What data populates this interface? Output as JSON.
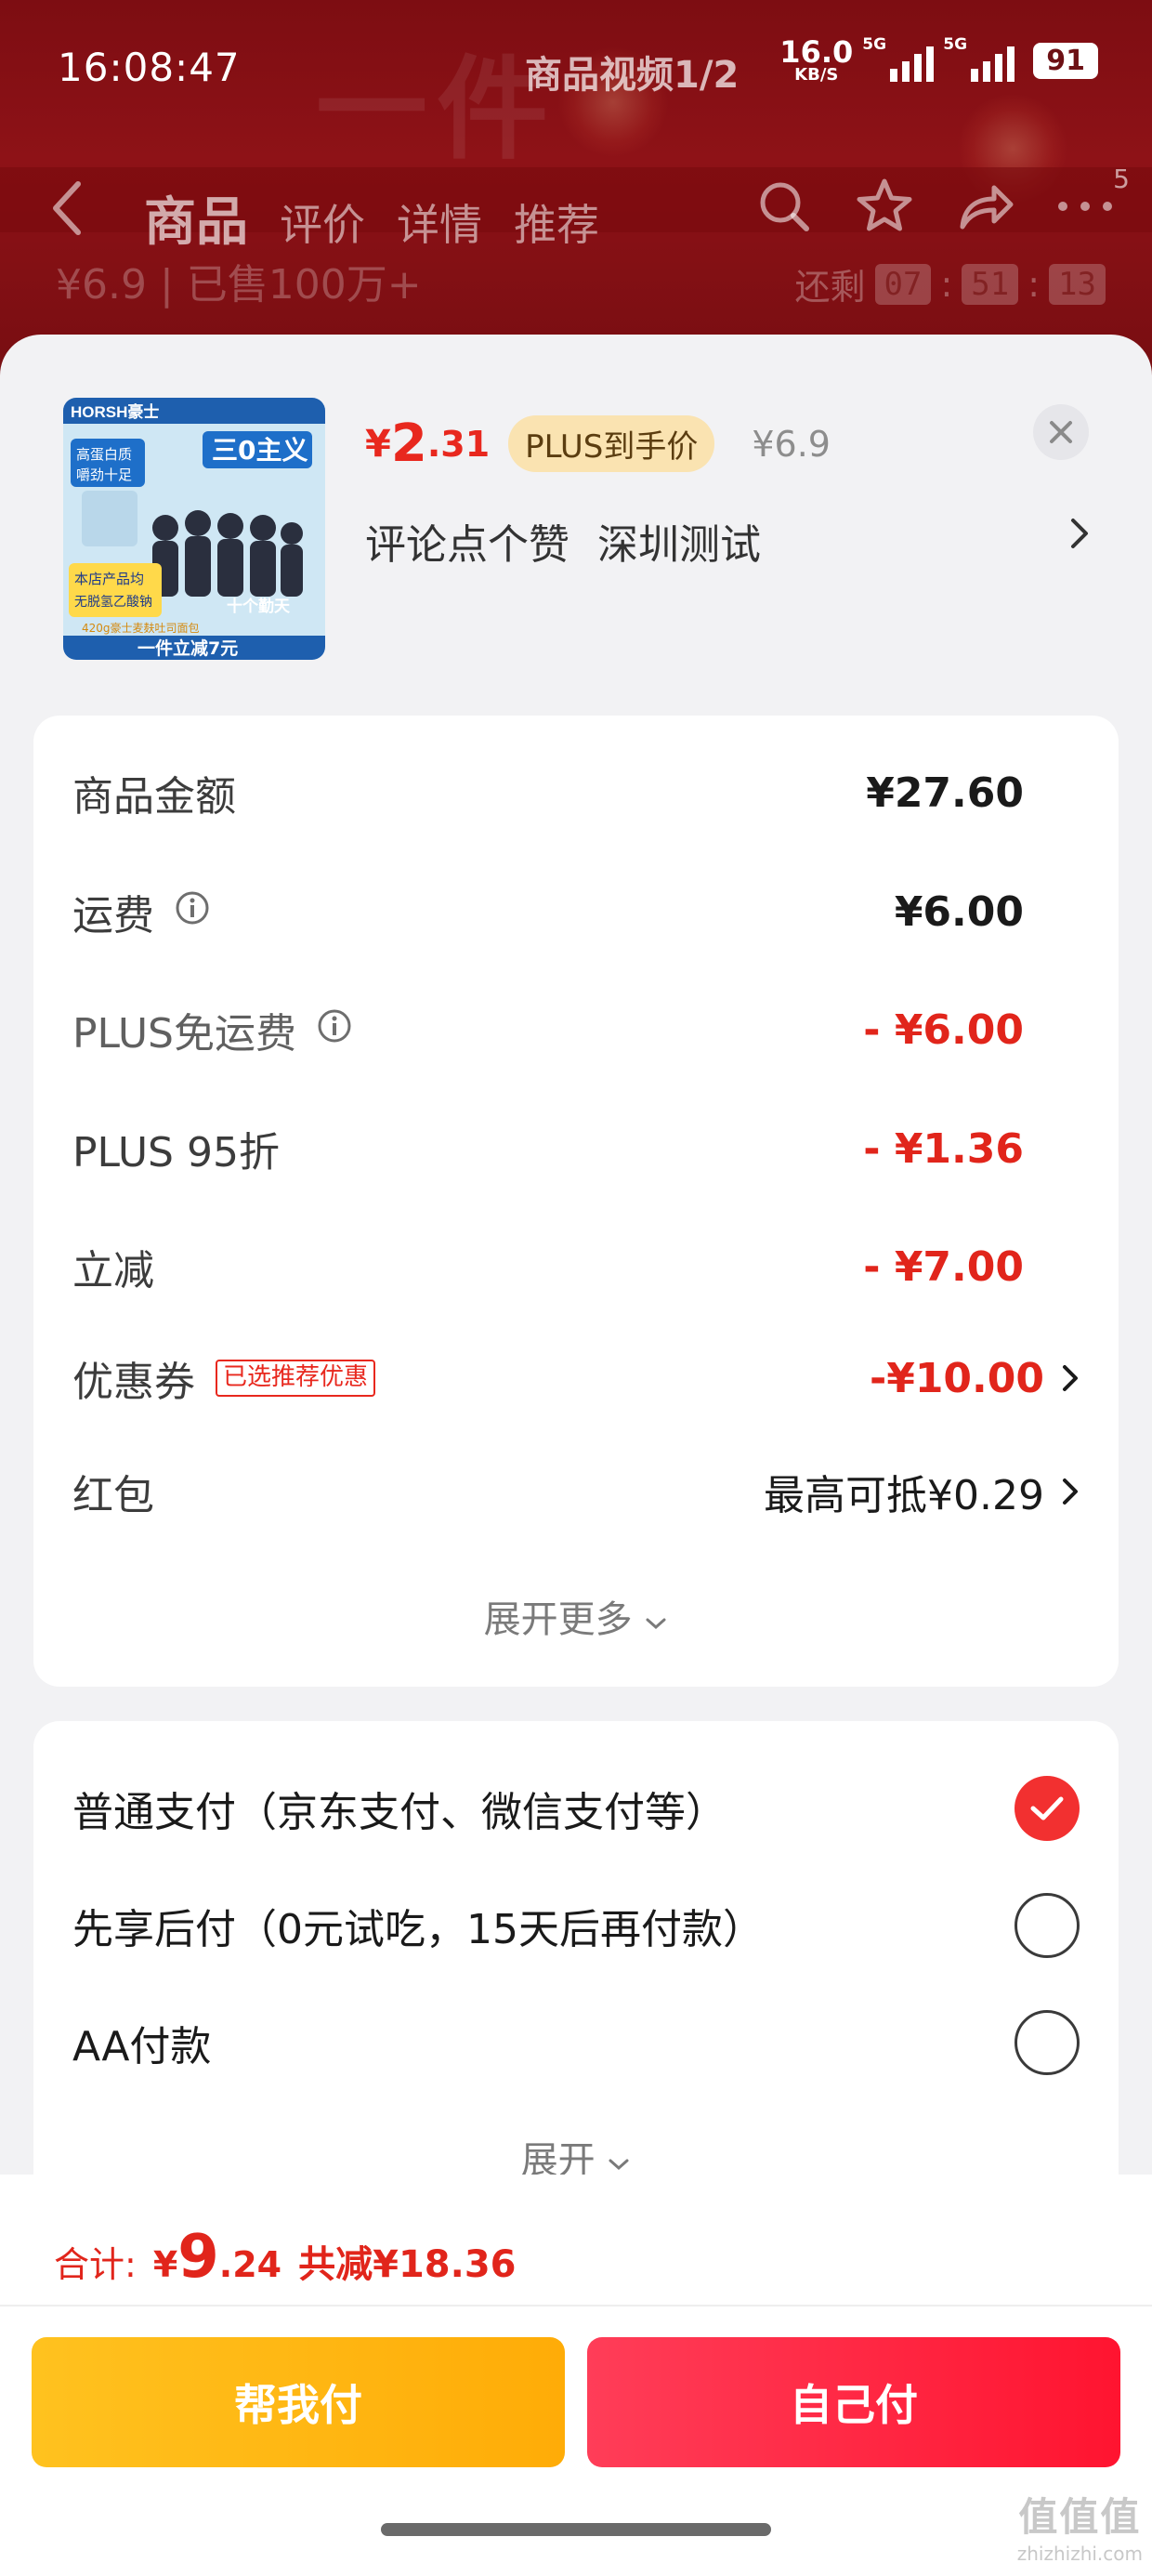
{
  "status_bar": {
    "time": "16:08:47",
    "video_label": "商品视频1/2",
    "net_speed": "16.0",
    "net_unit": "KB/S",
    "signal1": "5G",
    "signal2": "5G",
    "battery": "91"
  },
  "background": {
    "watermark": "一件",
    "sales": "¥6.9 | 已售100万+",
    "countdown_label": "还剩",
    "countdown": [
      "07",
      "51",
      "13"
    ]
  },
  "nav": {
    "tabs": [
      "商品",
      "评价",
      "详情",
      "推荐"
    ],
    "active_tab": "商品",
    "badge_count": "5"
  },
  "product": {
    "price_symbol": "¥",
    "price_int": "2",
    "price_dec": ".31",
    "plus_tag": "PLUS到手价",
    "original_price": "¥6.9",
    "variant": "评论点个赞",
    "region": "深圳测试",
    "thumb_text": {
      "brand": "HORSH豪士",
      "slogan": "三0主义",
      "tag1": "高蛋白质",
      "tag2": "嚼劲十足",
      "tag3": "本店产品均",
      "tag4": "无脱氢乙酸钠",
      "tag5": "十个勤天",
      "bottom": "一件立减7元",
      "sub": "420g豪士麦麸吐司面包"
    }
  },
  "cost": {
    "rows": [
      {
        "label": "商品金额",
        "value": "¥27.60"
      },
      {
        "label": "运费",
        "value": "¥6.00"
      },
      {
        "label": "PLUS免运费",
        "value": "- ¥6.00"
      },
      {
        "label": "PLUS 95折",
        "value": "- ¥1.36"
      },
      {
        "label": "立减",
        "value": "- ¥7.00"
      },
      {
        "label": "优惠券",
        "value": "-¥10.00",
        "tag": "已选推荐优惠"
      },
      {
        "label": "红包",
        "value": "最高可抵¥0.29"
      }
    ],
    "expand": "展开更多"
  },
  "payment": {
    "options": [
      {
        "label": "普通支付（京东支付、微信支付等）",
        "checked": true
      },
      {
        "label": "先享后付（0元试吃，15天后再付款）",
        "checked": false
      },
      {
        "label": "AA付款",
        "checked": false
      }
    ],
    "expand": "展开"
  },
  "footer": {
    "total_label": "合计:",
    "total_symbol": "¥",
    "total_int": "9",
    "total_dec": ".24",
    "savings": "共减¥18.36",
    "help_pay": "帮我付",
    "self_pay": "自己付"
  },
  "watermark": {
    "line1": "值值值",
    "line2": "zhizhizhi.com"
  },
  "colors": {
    "accent_red": "#e1251b",
    "help_btn": "#ffb412",
    "self_btn": "#ff2a44",
    "plus_tag_bg": "#fae3b1"
  }
}
